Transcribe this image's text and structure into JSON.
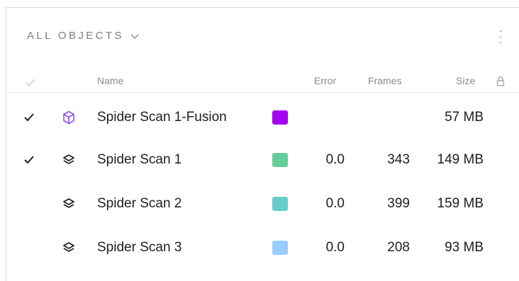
{
  "panel": {
    "title": "ALL OBJECTS",
    "title_icon": "chevron-down-icon",
    "menu_icon": "more-vertical-icon"
  },
  "columns": {
    "check_icon": "checkmark-icon",
    "name": "Name",
    "error": "Error",
    "frames": "Frames",
    "size": "Size",
    "lock_icon": "lock-icon"
  },
  "rows": [
    {
      "checked": true,
      "icon": "cube-icon",
      "name": "Spider Scan 1-Fusion",
      "color": "#a200f0",
      "error": "",
      "frames": "",
      "size": "57 MB"
    },
    {
      "checked": true,
      "icon": "layers-icon",
      "name": "Spider Scan 1",
      "color": "#66cc99",
      "error": "0.0",
      "frames": "343",
      "size": "149 MB"
    },
    {
      "checked": false,
      "icon": "layers-icon",
      "name": "Spider Scan 2",
      "color": "#66cccc",
      "error": "0.0",
      "frames": "399",
      "size": "159 MB"
    },
    {
      "checked": false,
      "icon": "layers-icon",
      "name": "Spider Scan 3",
      "color": "#99ccff",
      "error": "0.0",
      "frames": "208",
      "size": "93 MB"
    }
  ]
}
